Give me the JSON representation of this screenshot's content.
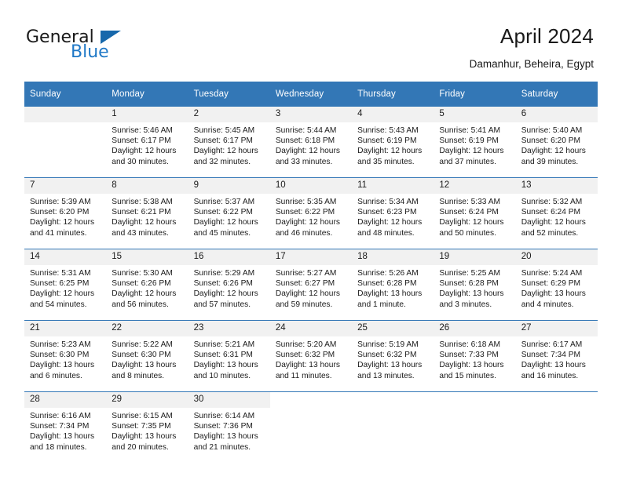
{
  "brand": {
    "name_top": "General",
    "name_bottom": "Blue",
    "triangle_color": "#1768ab",
    "blue_color": "#2079c7"
  },
  "header": {
    "title": "April 2024",
    "subtitle": "Damanhur, Beheira, Egypt"
  },
  "theme": {
    "header_bg": "#3377b6",
    "daynum_bg": "#f1f1f1",
    "text": "#1a1a1a"
  },
  "calendar": {
    "weekday_headers": [
      "Sunday",
      "Monday",
      "Tuesday",
      "Wednesday",
      "Thursday",
      "Friday",
      "Saturday"
    ],
    "weeks": [
      [
        {
          "day": "",
          "info": ""
        },
        {
          "day": "1",
          "info": "Sunrise: 5:46 AM\nSunset: 6:17 PM\nDaylight: 12 hours\nand 30 minutes."
        },
        {
          "day": "2",
          "info": "Sunrise: 5:45 AM\nSunset: 6:17 PM\nDaylight: 12 hours\nand 32 minutes."
        },
        {
          "day": "3",
          "info": "Sunrise: 5:44 AM\nSunset: 6:18 PM\nDaylight: 12 hours\nand 33 minutes."
        },
        {
          "day": "4",
          "info": "Sunrise: 5:43 AM\nSunset: 6:19 PM\nDaylight: 12 hours\nand 35 minutes."
        },
        {
          "day": "5",
          "info": "Sunrise: 5:41 AM\nSunset: 6:19 PM\nDaylight: 12 hours\nand 37 minutes."
        },
        {
          "day": "6",
          "info": "Sunrise: 5:40 AM\nSunset: 6:20 PM\nDaylight: 12 hours\nand 39 minutes."
        }
      ],
      [
        {
          "day": "7",
          "info": "Sunrise: 5:39 AM\nSunset: 6:20 PM\nDaylight: 12 hours\nand 41 minutes."
        },
        {
          "day": "8",
          "info": "Sunrise: 5:38 AM\nSunset: 6:21 PM\nDaylight: 12 hours\nand 43 minutes."
        },
        {
          "day": "9",
          "info": "Sunrise: 5:37 AM\nSunset: 6:22 PM\nDaylight: 12 hours\nand 45 minutes."
        },
        {
          "day": "10",
          "info": "Sunrise: 5:35 AM\nSunset: 6:22 PM\nDaylight: 12 hours\nand 46 minutes."
        },
        {
          "day": "11",
          "info": "Sunrise: 5:34 AM\nSunset: 6:23 PM\nDaylight: 12 hours\nand 48 minutes."
        },
        {
          "day": "12",
          "info": "Sunrise: 5:33 AM\nSunset: 6:24 PM\nDaylight: 12 hours\nand 50 minutes."
        },
        {
          "day": "13",
          "info": "Sunrise: 5:32 AM\nSunset: 6:24 PM\nDaylight: 12 hours\nand 52 minutes."
        }
      ],
      [
        {
          "day": "14",
          "info": "Sunrise: 5:31 AM\nSunset: 6:25 PM\nDaylight: 12 hours\nand 54 minutes."
        },
        {
          "day": "15",
          "info": "Sunrise: 5:30 AM\nSunset: 6:26 PM\nDaylight: 12 hours\nand 56 minutes."
        },
        {
          "day": "16",
          "info": "Sunrise: 5:29 AM\nSunset: 6:26 PM\nDaylight: 12 hours\nand 57 minutes."
        },
        {
          "day": "17",
          "info": "Sunrise: 5:27 AM\nSunset: 6:27 PM\nDaylight: 12 hours\nand 59 minutes."
        },
        {
          "day": "18",
          "info": "Sunrise: 5:26 AM\nSunset: 6:28 PM\nDaylight: 13 hours\nand 1 minute."
        },
        {
          "day": "19",
          "info": "Sunrise: 5:25 AM\nSunset: 6:28 PM\nDaylight: 13 hours\nand 3 minutes."
        },
        {
          "day": "20",
          "info": "Sunrise: 5:24 AM\nSunset: 6:29 PM\nDaylight: 13 hours\nand 4 minutes."
        }
      ],
      [
        {
          "day": "21",
          "info": "Sunrise: 5:23 AM\nSunset: 6:30 PM\nDaylight: 13 hours\nand 6 minutes."
        },
        {
          "day": "22",
          "info": "Sunrise: 5:22 AM\nSunset: 6:30 PM\nDaylight: 13 hours\nand 8 minutes."
        },
        {
          "day": "23",
          "info": "Sunrise: 5:21 AM\nSunset: 6:31 PM\nDaylight: 13 hours\nand 10 minutes."
        },
        {
          "day": "24",
          "info": "Sunrise: 5:20 AM\nSunset: 6:32 PM\nDaylight: 13 hours\nand 11 minutes."
        },
        {
          "day": "25",
          "info": "Sunrise: 5:19 AM\nSunset: 6:32 PM\nDaylight: 13 hours\nand 13 minutes."
        },
        {
          "day": "26",
          "info": "Sunrise: 6:18 AM\nSunset: 7:33 PM\nDaylight: 13 hours\nand 15 minutes."
        },
        {
          "day": "27",
          "info": "Sunrise: 6:17 AM\nSunset: 7:34 PM\nDaylight: 13 hours\nand 16 minutes."
        }
      ],
      [
        {
          "day": "28",
          "info": "Sunrise: 6:16 AM\nSunset: 7:34 PM\nDaylight: 13 hours\nand 18 minutes."
        },
        {
          "day": "29",
          "info": "Sunrise: 6:15 AM\nSunset: 7:35 PM\nDaylight: 13 hours\nand 20 minutes."
        },
        {
          "day": "30",
          "info": "Sunrise: 6:14 AM\nSunset: 7:36 PM\nDaylight: 13 hours\nand 21 minutes."
        },
        {
          "day": "",
          "info": ""
        },
        {
          "day": "",
          "info": ""
        },
        {
          "day": "",
          "info": ""
        },
        {
          "day": "",
          "info": ""
        }
      ]
    ]
  }
}
